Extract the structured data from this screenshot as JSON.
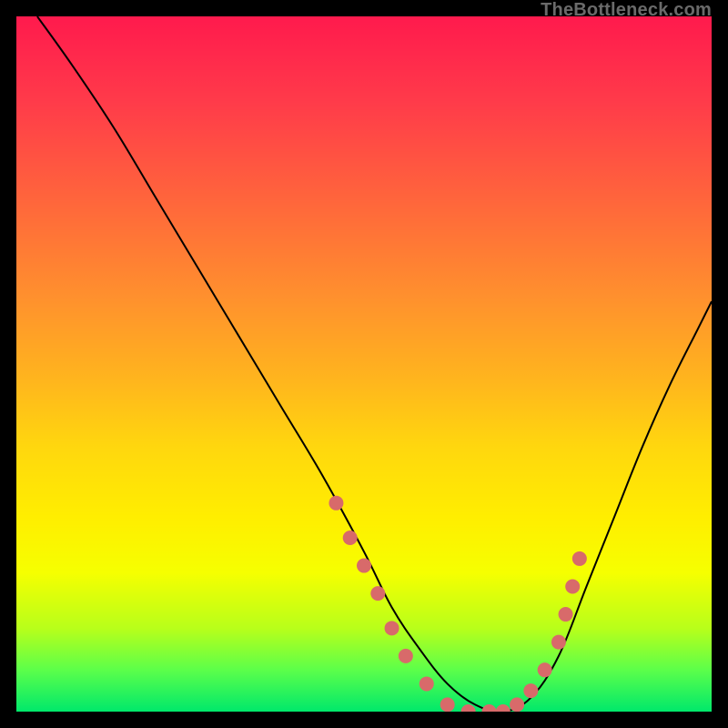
{
  "watermark": "TheBottleneck.com",
  "chart_data": {
    "type": "line",
    "title": "",
    "xlabel": "",
    "ylabel": "",
    "xlim": [
      0,
      100
    ],
    "ylim": [
      0,
      100
    ],
    "series": [
      {
        "name": "curve",
        "x": [
          3,
          8,
          14,
          20,
          26,
          32,
          38,
          44,
          50,
          54,
          58,
          62,
          66,
          70,
          74,
          78,
          82,
          86,
          90,
          94,
          98,
          100
        ],
        "y": [
          100,
          93,
          84,
          74,
          64,
          54,
          44,
          34,
          23,
          15,
          9,
          4,
          1,
          0,
          2,
          8,
          18,
          28,
          38,
          47,
          55,
          59
        ]
      }
    ],
    "markers": [
      {
        "x": 46,
        "y": 30
      },
      {
        "x": 48,
        "y": 25
      },
      {
        "x": 50,
        "y": 21
      },
      {
        "x": 52,
        "y": 17
      },
      {
        "x": 54,
        "y": 12
      },
      {
        "x": 56,
        "y": 8
      },
      {
        "x": 59,
        "y": 4
      },
      {
        "x": 62,
        "y": 1
      },
      {
        "x": 65,
        "y": 0
      },
      {
        "x": 68,
        "y": 0
      },
      {
        "x": 70,
        "y": 0
      },
      {
        "x": 72,
        "y": 1
      },
      {
        "x": 74,
        "y": 3
      },
      {
        "x": 76,
        "y": 6
      },
      {
        "x": 78,
        "y": 10
      },
      {
        "x": 79,
        "y": 14
      },
      {
        "x": 80,
        "y": 18
      },
      {
        "x": 81,
        "y": 22
      }
    ],
    "marker_color": "#d86a6a",
    "gradient_stops": [
      {
        "pos": 0.0,
        "color": "#ff1a4d"
      },
      {
        "pos": 0.28,
        "color": "#ff6a3a"
      },
      {
        "pos": 0.52,
        "color": "#ffb41e"
      },
      {
        "pos": 0.72,
        "color": "#ffee00"
      },
      {
        "pos": 0.88,
        "color": "#b8ff1a"
      },
      {
        "pos": 1.0,
        "color": "#00e86b"
      }
    ]
  }
}
